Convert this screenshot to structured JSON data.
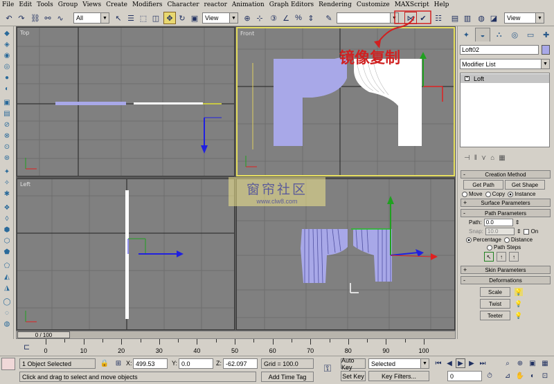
{
  "menu": [
    "File",
    "Edit",
    "Tools",
    "Group",
    "Views",
    "Create",
    "Modifiers",
    "Character",
    "reactor",
    "Animation",
    "Graph Editors",
    "Rendering",
    "Customize",
    "MAXScript",
    "Help"
  ],
  "toolbar": {
    "selection_filter": "All",
    "ref_coord": "View",
    "named_selection": "",
    "view_combo": "View"
  },
  "viewports": {
    "top": {
      "label": "Top"
    },
    "front": {
      "label": "Front"
    },
    "left": {
      "label": "Left"
    },
    "perspective": {
      "label": ""
    }
  },
  "annotation": "镜像复制",
  "watermark": {
    "line1": "窗帘社区",
    "line2": "www.clw8.com"
  },
  "command_panel": {
    "object_name": "Loft02",
    "object_color": "#a8a8e8",
    "modifier_list": "Modifier List",
    "stack_item": "Loft",
    "creation_method": {
      "title": "Creation Method",
      "get_path": "Get Path",
      "get_shape": "Get Shape",
      "options": [
        "Move",
        "Copy",
        "Instance"
      ],
      "selected": "Instance"
    },
    "surface_parameters": "Surface Parameters",
    "path_parameters": {
      "title": "Path Parameters",
      "path_label": "Path:",
      "path_value": "0.0",
      "snap_label": "Snap:",
      "snap_value": "10.0",
      "on_label": "On",
      "percentage": "Percentage",
      "distance": "Distance",
      "path_steps": "Path Steps"
    },
    "skin_parameters": "Skin Parameters",
    "deformations": {
      "title": "Deformations",
      "scale": "Scale",
      "twist": "Twist",
      "teeter": "Teeter"
    }
  },
  "timeline": {
    "slider": "0 / 100",
    "ticks": [
      "0",
      "10",
      "20",
      "30",
      "40",
      "50",
      "60",
      "70",
      "80",
      "90",
      "100"
    ]
  },
  "status": {
    "selection": "1 Object Selected",
    "prompt": "Click and drag to select and move objects",
    "x_label": "X:",
    "x": "499.53",
    "y_label": "Y:",
    "y": "0.0",
    "z_label": "Z:",
    "z": "-62.097",
    "grid": "Grid = 100.0",
    "add_time_tag": "Add Time Tag",
    "auto_key": "Auto Key",
    "set_key": "Set Key",
    "key_mode": "Selected",
    "key_filters": "Key Filters...",
    "frame": "0"
  }
}
